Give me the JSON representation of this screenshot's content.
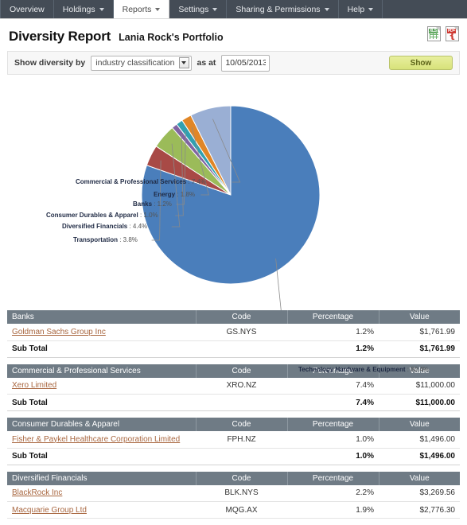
{
  "nav": {
    "items": [
      {
        "label": "Overview",
        "caret": false,
        "active": false
      },
      {
        "label": "Holdings",
        "caret": true,
        "active": false
      },
      {
        "label": "Reports",
        "caret": true,
        "active": true
      },
      {
        "label": "Settings",
        "caret": true,
        "active": false
      },
      {
        "label": "Sharing & Permissions",
        "caret": true,
        "active": false
      },
      {
        "label": "Help",
        "caret": true,
        "active": false
      }
    ]
  },
  "header": {
    "title": "Diversity Report",
    "subtitle": "Lania Rock's Portfolio",
    "export": [
      {
        "name": "xls-export-icon",
        "tag": "XLS"
      },
      {
        "name": "pdf-export-icon",
        "tag": "PDF"
      }
    ]
  },
  "filter": {
    "label_before": "Show diversity by",
    "select_value": "industry classification",
    "select_options": [
      "industry classification"
    ],
    "label_middle": "as at",
    "date_value": "10/05/2013",
    "date_placeholder": "dd/mm/yyyy",
    "show_button": "Show"
  },
  "chart_data": {
    "type": "pie",
    "title": "",
    "legend_position": "callout-labels",
    "unit": "%",
    "categories": [
      "Technology Hardware & Equipment",
      "Commercial & Professional Services",
      "Energy",
      "Banks",
      "Consumer Durables & Apparel",
      "Diversified Financials",
      "Transportation"
    ],
    "values": [
      80.4,
      7.4,
      1.8,
      1.2,
      1.0,
      4.4,
      3.8
    ],
    "colors": [
      "#4a7ebb",
      "#9aafd4",
      "#e08627",
      "#31a0b0",
      "#8064a2",
      "#9bbb59",
      "#a84a46"
    ],
    "labels": [
      {
        "text": "Technology Hardware & Equipment",
        "value": "80.4%"
      },
      {
        "text": "Commercial & Professional Services",
        "value": "7.4%"
      },
      {
        "text": "Energy",
        "value": "1.8%"
      },
      {
        "text": "Banks",
        "value": "1.2%"
      },
      {
        "text": "Consumer Durables & Apparel",
        "value": "1.0%"
      },
      {
        "text": "Diversified Financials",
        "value": "4.4%"
      },
      {
        "text": "Transportation",
        "value": "3.8%"
      }
    ]
  },
  "tables": {
    "columns": [
      "Code",
      "Percentage",
      "Value"
    ],
    "subtotal_label": "Sub Total",
    "groups": [
      {
        "name": "Banks",
        "rows": [
          {
            "security": "Goldman Sachs Group Inc",
            "code": "GS.NYS",
            "percentage": "1.2%",
            "value": "$1,761.99"
          }
        ],
        "subtotal": {
          "percentage": "1.2%",
          "value": "$1,761.99"
        }
      },
      {
        "name": "Commercial & Professional Services",
        "rows": [
          {
            "security": "Xero Limited",
            "code": "XRO.NZ",
            "percentage": "7.4%",
            "value": "$11,000.00"
          }
        ],
        "subtotal": {
          "percentage": "7.4%",
          "value": "$11,000.00"
        }
      },
      {
        "name": "Consumer Durables & Apparel",
        "rows": [
          {
            "security": "Fisher & Paykel Healthcare Corporation Limited",
            "code": "FPH.NZ",
            "percentage": "1.0%",
            "value": "$1,496.00"
          }
        ],
        "subtotal": {
          "percentage": "1.0%",
          "value": "$1,496.00"
        }
      },
      {
        "name": "Diversified Financials",
        "rows": [
          {
            "security": "BlackRock Inc",
            "code": "BLK.NYS",
            "percentage": "2.2%",
            "value": "$3,269.56"
          },
          {
            "security": "Macquarie Group Ltd",
            "code": "MQG.AX",
            "percentage": "1.9%",
            "value": "$2,776.30"
          }
        ],
        "subtotal": null
      }
    ]
  }
}
